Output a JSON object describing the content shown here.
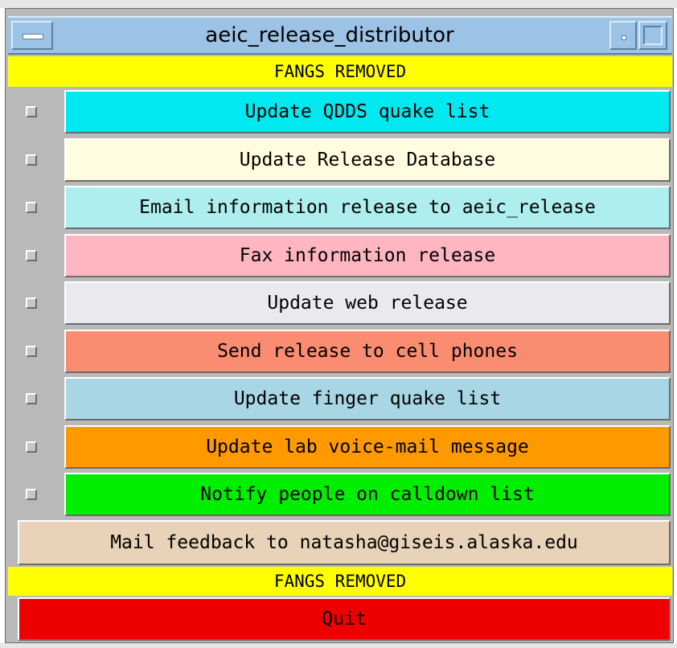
{
  "window": {
    "title": "aeic_release_distributor"
  },
  "banner_top": "FANGS REMOVED",
  "banner_bottom": "FANGS REMOVED",
  "tasks": [
    {
      "label": "Update QDDS quake list",
      "color": "#00e8f0",
      "checked": false
    },
    {
      "label": "Update Release Database",
      "color": "#fffde0",
      "checked": false
    },
    {
      "label": "Email information release to aeic_release",
      "color": "#aeeeee",
      "checked": false
    },
    {
      "label": "Fax information release",
      "color": "#ffb6c1",
      "checked": false
    },
    {
      "label": "Update web release",
      "color": "#eaeaee",
      "checked": false
    },
    {
      "label": "Send release to cell phones",
      "color": "#fa8c72",
      "checked": false
    },
    {
      "label": "Update finger quake list",
      "color": "#a8d6e4",
      "checked": false
    },
    {
      "label": "Update lab voice-mail message",
      "color": "#ff9900",
      "checked": false
    },
    {
      "label": "Notify people on calldown list",
      "color": "#00ee00",
      "checked": false
    }
  ],
  "mail_button": {
    "label": "Mail feedback to natasha@giseis.alaska.edu",
    "color": "#e8d2b8"
  },
  "quit_button": {
    "label": "Quit",
    "color": "#ee0000"
  }
}
